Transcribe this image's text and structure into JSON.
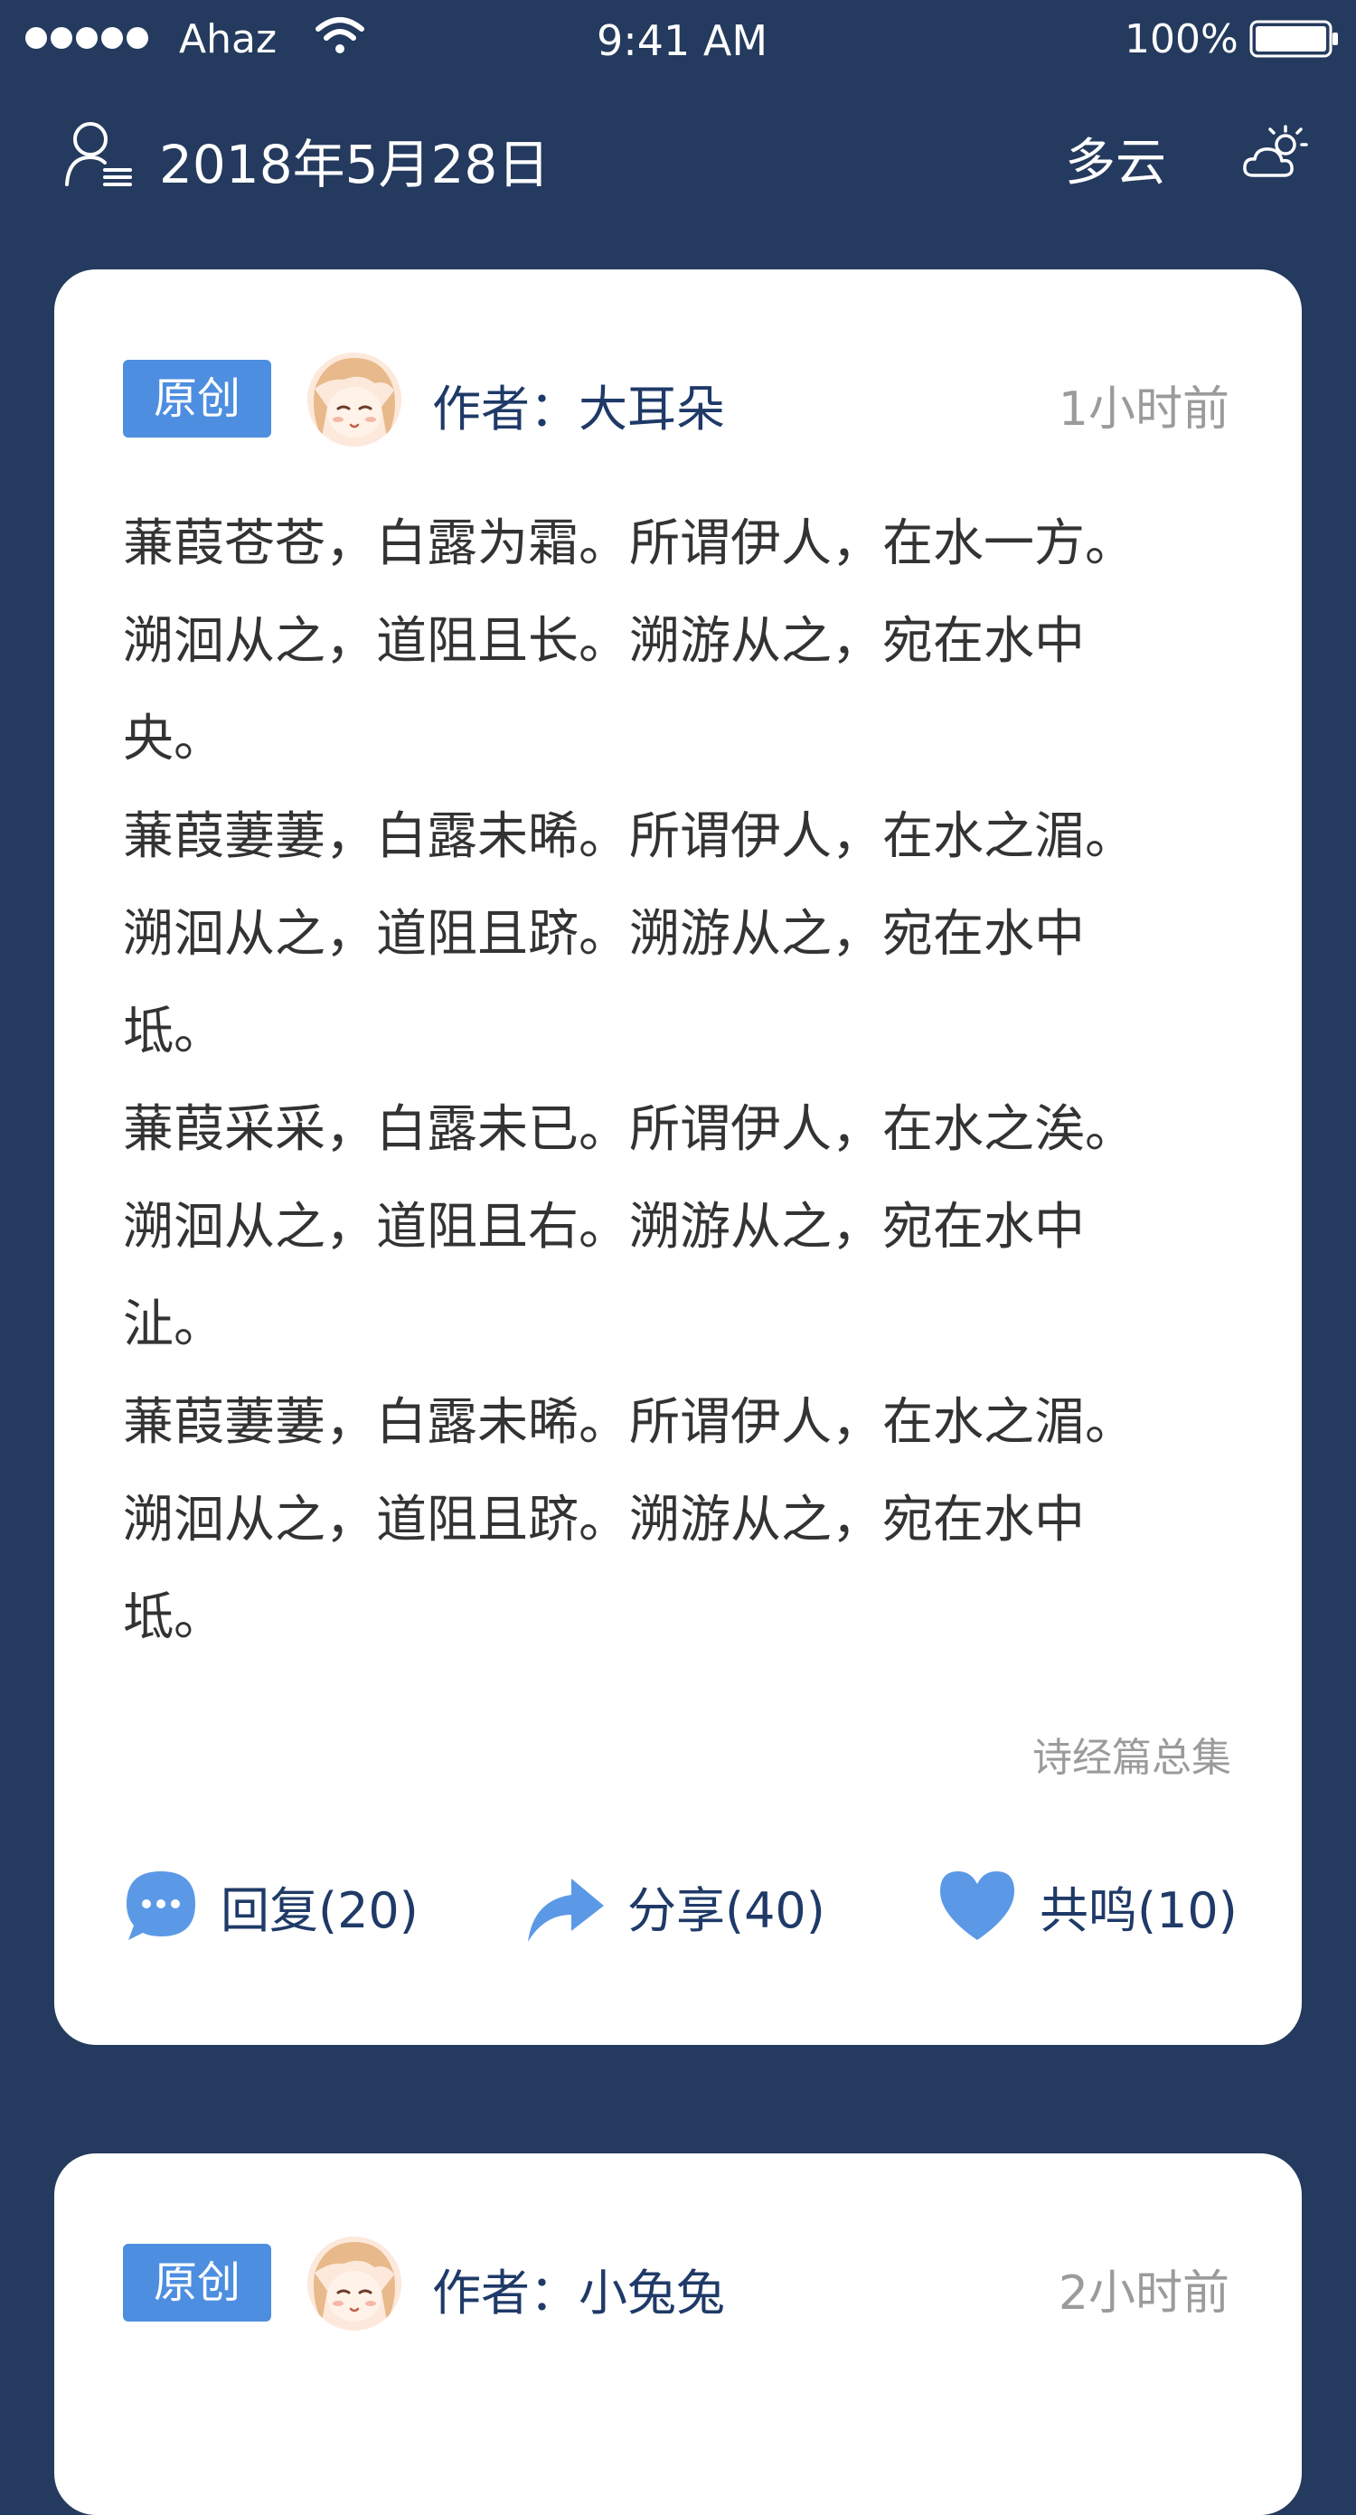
{
  "status_bar": {
    "carrier": "Ahaz",
    "time": "9:41 AM",
    "battery": "100%"
  },
  "header": {
    "date": "2018年5月28日",
    "weather": "多云",
    "icons": [
      "user-list-icon",
      "partly-cloudy-icon"
    ]
  },
  "posts": [
    {
      "badge": "原创",
      "author": "作者：大耳朵",
      "time": "1小时前",
      "lines": [
        "蒹葭苍苍，白露为霜。所谓伊人，在水一方。",
        "溯洄从之，道阻且长。溯游从之，宛在水中",
        "央。",
        "蒹葭萋萋，白露未晞。所谓伊人，在水之湄。",
        "溯洄从之，道阻且跻。溯游从之，宛在水中",
        "坻。",
        "蒹葭采采，白露未已。所谓伊人，在水之涘。",
        "溯洄从之，道阻且右。溯游从之，宛在水中",
        "沚。",
        "蒹葭萋萋，白露未晞。所谓伊人，在水之湄。",
        "溯洄从之，道阻且跻。溯游从之，宛在水中",
        "坻。"
      ],
      "source": "诗经篇总集",
      "actions": {
        "reply": "回复(20)",
        "share": "分享(40)",
        "resonate": "共鸣(10)"
      }
    },
    {
      "badge": "原创",
      "author": "作者：小兔兔",
      "time": "2小时前"
    }
  ],
  "colors": {
    "background": "#243a5e",
    "accent": "#4d8ee0",
    "author_text": "#1f3a68",
    "muted": "#9b9b9b"
  }
}
